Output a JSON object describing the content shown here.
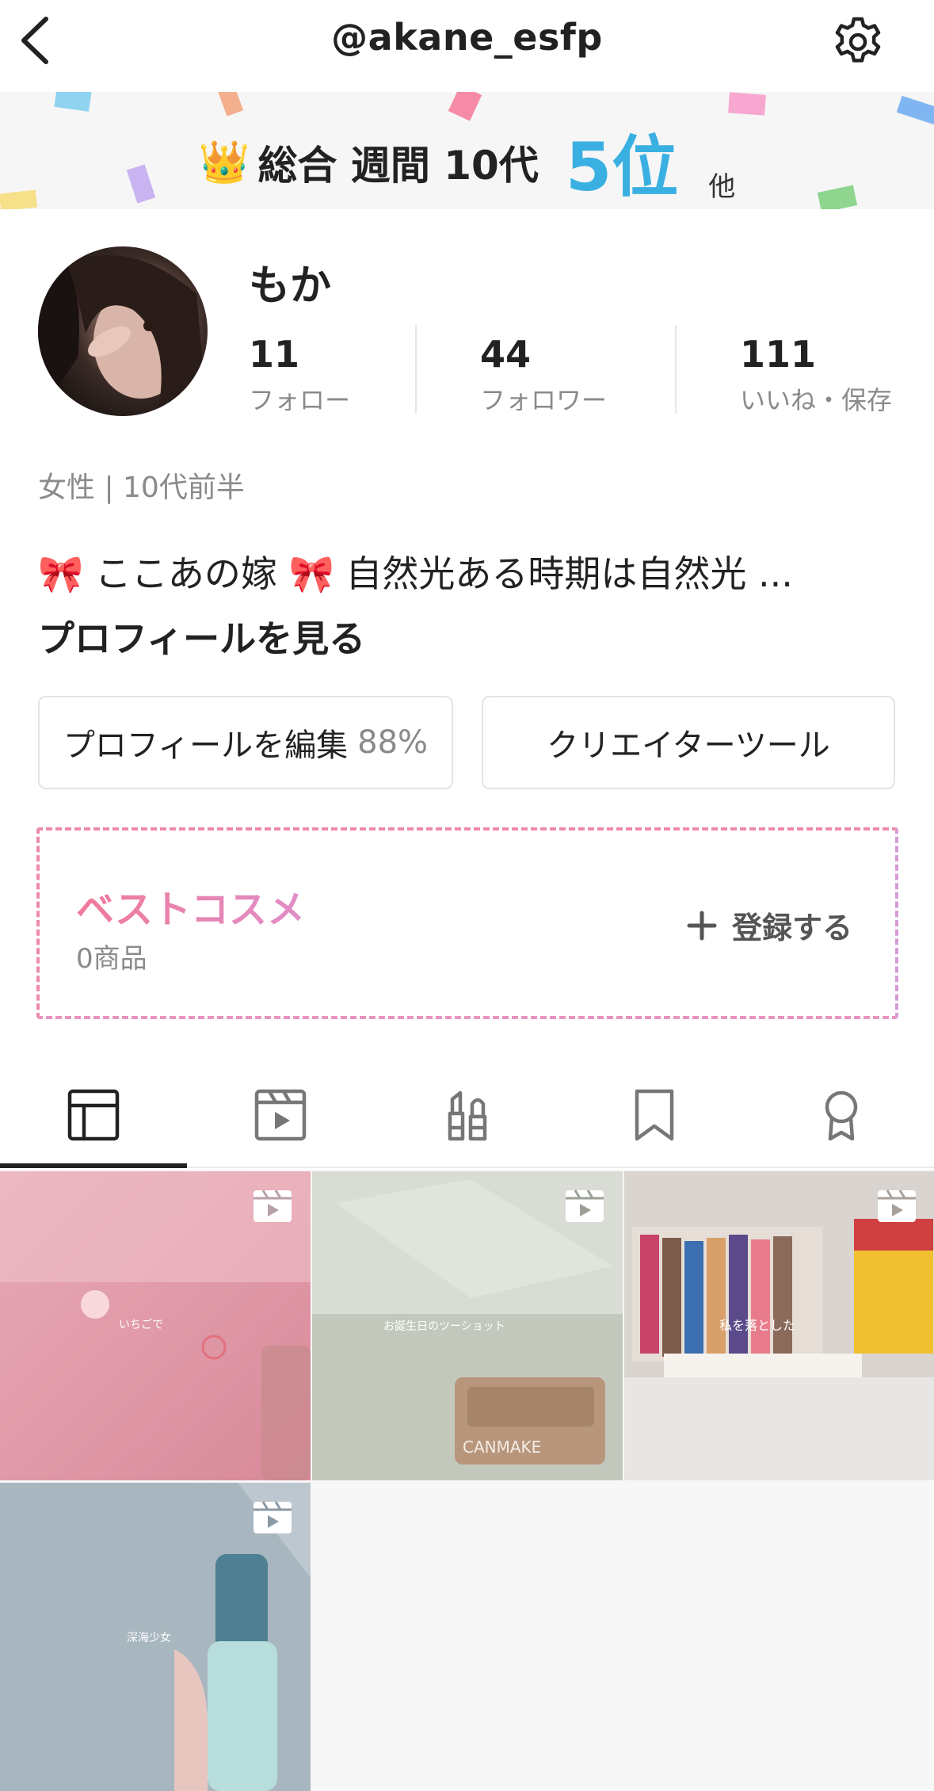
{
  "header": {
    "username": "@akane_esfp"
  },
  "ranking": {
    "crown_icon": "👑",
    "label": "総合 週間 10代",
    "rank": "5位",
    "suffix": "他"
  },
  "profile": {
    "display_name": "もか",
    "stats": [
      {
        "value": "11",
        "label": "フォロー"
      },
      {
        "value": "44",
        "label": "フォロワー"
      },
      {
        "value": "111",
        "label": "いいね・保存"
      }
    ],
    "meta": "女性 | 10代前半",
    "bio": "🎀 ここあの嫁 🎀 自然光ある時期は自然光  ...",
    "see_profile": "プロフィールを見る"
  },
  "buttons": {
    "edit_profile": "プロフィールを編集",
    "edit_progress": "88%",
    "creator_tool": "クリエイターツール"
  },
  "best_cosme": {
    "title": "ベストコスメ",
    "count": "0商品",
    "register": "登録する"
  },
  "tabs": [
    {
      "icon": "grid-icon",
      "active": true
    },
    {
      "icon": "video-icon",
      "active": false
    },
    {
      "icon": "cosmetics-icon",
      "active": false
    },
    {
      "icon": "bookmark-icon",
      "active": false
    },
    {
      "icon": "award-icon",
      "active": false
    }
  ],
  "posts": [
    {
      "type": "video",
      "overlay_text": "いちごで"
    },
    {
      "type": "video",
      "overlay_text": "お誕生日のツーショット"
    },
    {
      "type": "video",
      "overlay_text": "私を落とした"
    },
    {
      "type": "video",
      "overlay_text": "深海少女"
    }
  ],
  "colors": {
    "rank_accent": "#3ab0e2",
    "cosme_gradient_start": "#f07a9a",
    "cosme_gradient_end": "#e08ec8"
  }
}
